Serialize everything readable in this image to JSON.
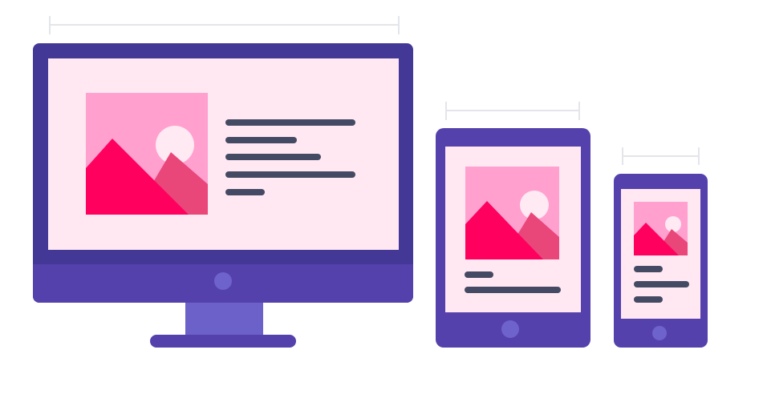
{
  "colors": {
    "background": "#ffffff",
    "frame_dark": "#443896",
    "frame": "#5541ac",
    "screen": "#ffe8f2",
    "sky": "#ffa0cf",
    "sun": "#ffe9f3",
    "mountain_front": "#ff005e",
    "mountain_back": "#e94679",
    "text_line": "#444a63",
    "stand": "#6b61c9",
    "button": "#6e62cc",
    "dimension_line": "#e4e5ea"
  },
  "devices": [
    {
      "id": "desktop",
      "kind": "monitor",
      "text_lines": 5
    },
    {
      "id": "tablet",
      "kind": "tablet",
      "text_lines": 2
    },
    {
      "id": "phone",
      "kind": "phone",
      "text_lines": 3
    }
  ],
  "icons": {
    "image_placeholder": "image-placeholder-icon",
    "home_button": "home-button-icon",
    "width_indicator": "width-indicator-icon"
  }
}
